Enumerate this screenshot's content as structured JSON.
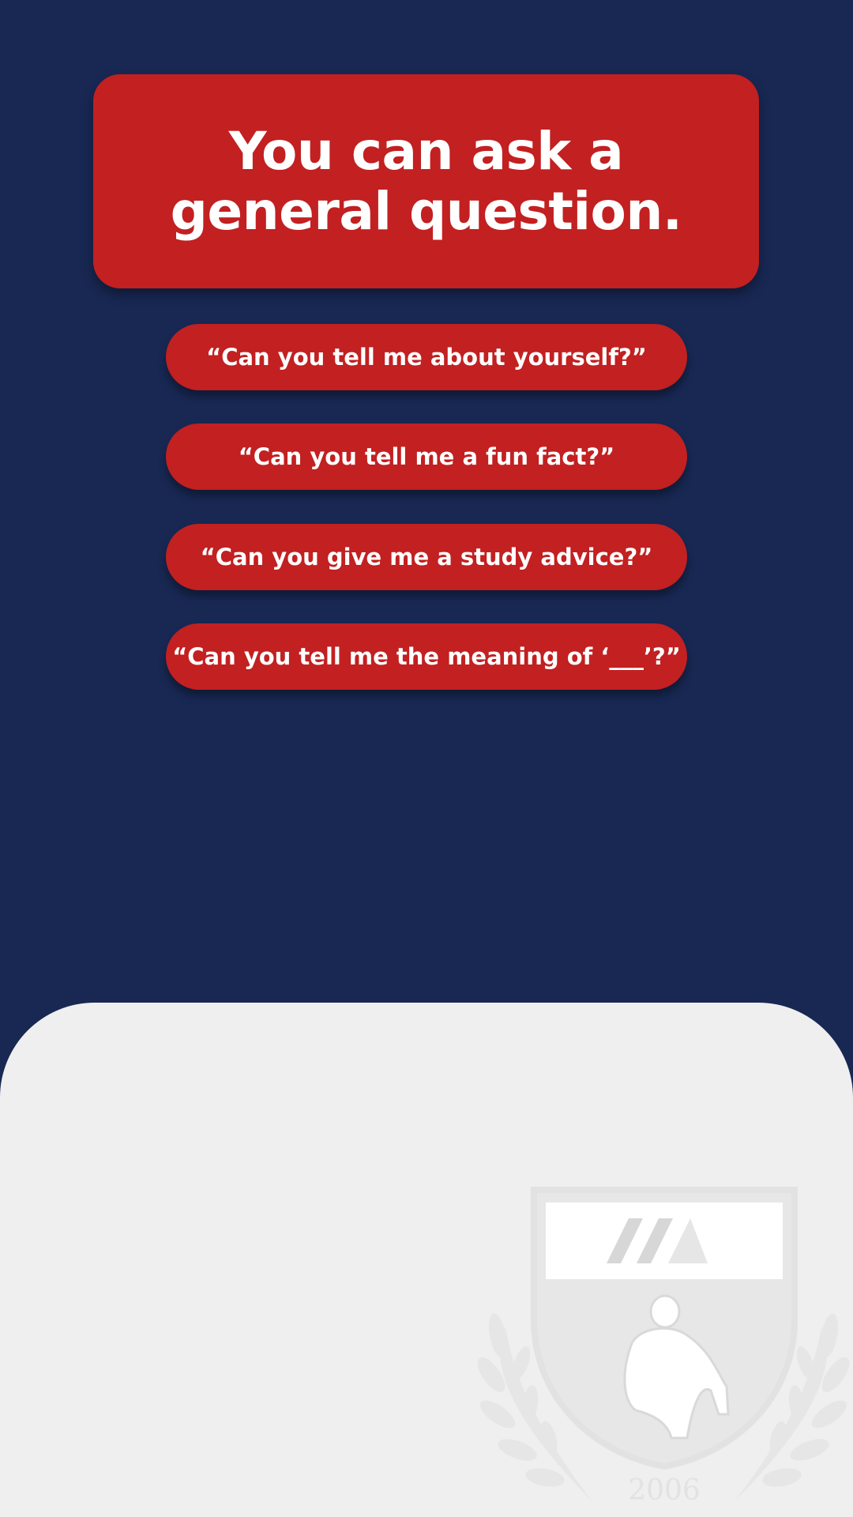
{
  "header": {
    "title": "You can ask a general question."
  },
  "questions": [
    "“Can you tell me about yourself?”",
    "“Can you tell me a fun fact?”",
    "“Can you give me a study advice?”",
    "“Can you tell me the meaning of ‘___’?”"
  ],
  "crest": {
    "year": "2006"
  },
  "colors": {
    "background": "#182853",
    "accent": "#c22021",
    "panel": "#efefef"
  }
}
